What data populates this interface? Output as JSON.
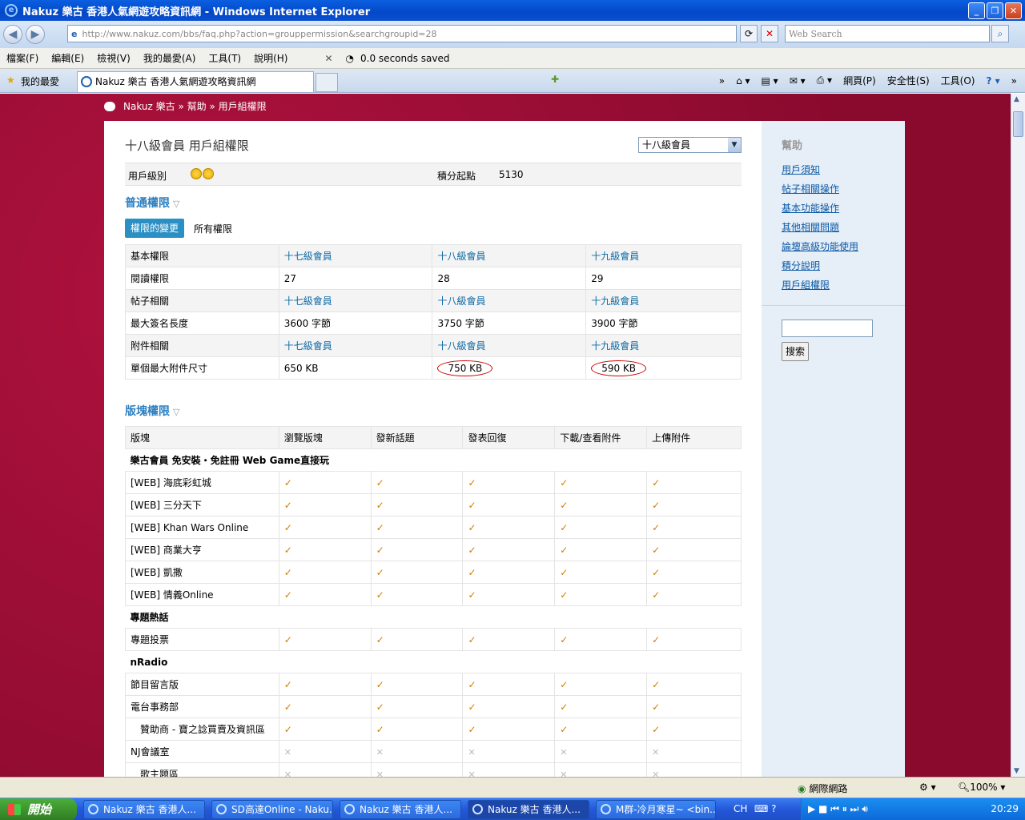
{
  "window": {
    "title": "Nakuz 樂古 香港人氣網遊攻略資訊網 - Windows Internet Explorer"
  },
  "browser": {
    "url": "http://www.nakuz.com/bbs/faq.php?action=grouppermission&searchgroupid=28",
    "search_placeholder": "Web Search",
    "menu": [
      "檔案(F)",
      "編輯(E)",
      "檢視(V)",
      "我的最愛(A)",
      "工具(T)",
      "說明(H)"
    ],
    "saved_text": "0.0 seconds saved",
    "favorites_label": "我的最愛",
    "tab_title": "Nakuz 樂古 香港人氣網遊攻略資訊網",
    "cmd": {
      "page": "網頁(P)",
      "safety": "安全性(S)",
      "tools": "工具(O)"
    }
  },
  "breadcrumb": {
    "site": "Nakuz 樂古",
    "sep1": "»",
    "help": "幫助",
    "sep2": "»",
    "current": "用戶組權限"
  },
  "page": {
    "title": "十八級會員 用戶組權限",
    "group_select": "十八級會員",
    "user_level_label": "用戶級別",
    "points_label": "積分起點",
    "points_value": "5130"
  },
  "general": {
    "heading": "普通權限",
    "tab_changes": "權限的變更",
    "tab_all": "所有權限",
    "rows": [
      {
        "label": "基本權限",
        "c1": "十七級會員",
        "c2": "十八級會員",
        "c3": "十九級會員",
        "link": true
      },
      {
        "label": "閱讀權限",
        "c1": "27",
        "c2": "28",
        "c3": "29"
      },
      {
        "label": "帖子相關",
        "c1": "十七級會員",
        "c2": "十八級會員",
        "c3": "十九級會員",
        "link": true
      },
      {
        "label": "最大簽名長度",
        "c1": "3600 字節",
        "c2": "3750 字節",
        "c3": "3900 字節"
      },
      {
        "label": "附件相關",
        "c1": "十七級會員",
        "c2": "十八級會員",
        "c3": "十九級會員",
        "link": true
      },
      {
        "label": "單個最大附件尺寸",
        "c1": "650 KB",
        "c2": "750 KB",
        "c3": "590 KB",
        "circled": true
      }
    ]
  },
  "forum": {
    "heading": "版塊權限",
    "headers": [
      "版塊",
      "瀏覽版塊",
      "發新話題",
      "發表回復",
      "下載/查看附件",
      "上傳附件"
    ],
    "rows": [
      {
        "cat": "樂古會員 免安裝・免註冊 Web Game直接玩"
      },
      {
        "label": "[WEB] 海底彩虹城",
        "p": "yyyyy"
      },
      {
        "label": "[WEB] 三分天下",
        "p": "yyyyy"
      },
      {
        "label": "[WEB] Khan Wars Online",
        "p": "yyyyy"
      },
      {
        "label": "[WEB] 商業大亨",
        "p": "yyyyy"
      },
      {
        "label": "[WEB] 凱撒",
        "p": "yyyyy"
      },
      {
        "label": "[WEB] 情義Online",
        "p": "yyyyy"
      },
      {
        "cat": "專題熱話"
      },
      {
        "label": "專題投票",
        "p": "yyyyy"
      },
      {
        "cat": "nRadio"
      },
      {
        "label": "節目留言版",
        "p": "yyyyy"
      },
      {
        "label": "電台事務部",
        "p": "yyyyy"
      },
      {
        "label": "　贊助商 - 寶之諗買賣及資訊區",
        "p": "yyyyy"
      },
      {
        "label": "NJ會議室",
        "p": "nnnnn"
      },
      {
        "label": "　歌主題區",
        "p": "nnnnn"
      }
    ]
  },
  "sidebar": {
    "heading": "幫助",
    "links": [
      "用戶須知",
      "帖子相關操作",
      "基本功能操作",
      "其他相關問題",
      "論壇高級功能使用",
      "積分說明",
      "用戶組權限"
    ],
    "search_button": "搜索"
  },
  "status": {
    "zone": "網際網路",
    "zoom": "100%"
  },
  "taskbar": {
    "start": "開始",
    "items": [
      "Nakuz 樂古 香港人...",
      "SD高達Online - Naku...",
      "Nakuz 樂古 香港人...",
      "Nakuz 樂古 香港人...",
      "M群-冷月寒星~ <bin..."
    ],
    "lang": "CH",
    "clock": "20:29"
  }
}
